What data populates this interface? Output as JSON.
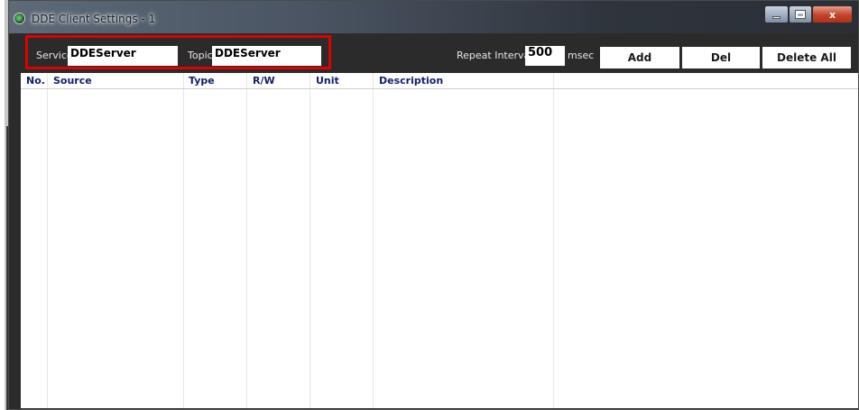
{
  "window": {
    "title": "DDE Client Settings - 1",
    "buttons": {
      "close": "x"
    }
  },
  "toolbar": {
    "service_label": "Service",
    "service_value": "DDEServer",
    "topic_label": "Topic",
    "topic_value": "DDEServer",
    "repeat_label": "Repeat Interval",
    "repeat_value": "500",
    "repeat_unit": "msec",
    "add_label": "Add",
    "del_label": "Del",
    "delete_all_label": "Delete All"
  },
  "table": {
    "columns": [
      "No.",
      "Source",
      "Type",
      "R/W",
      "Unit",
      "Description"
    ],
    "rows": []
  },
  "colors": {
    "highlight_box": "#e00000",
    "header_text": "#0f1f6a",
    "toolbar_bg": "#2b2b2b"
  }
}
